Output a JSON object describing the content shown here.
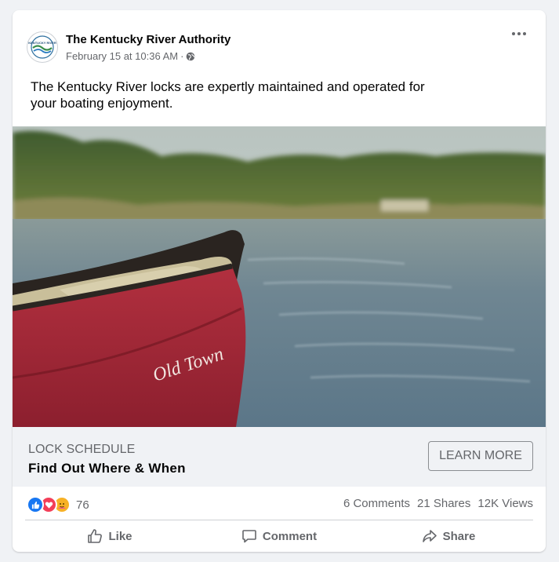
{
  "post": {
    "page_name": "The Kentucky River Authority",
    "timestamp": "February 15 at 10:36 AM",
    "separator": "·",
    "privacy_icon": "globe-icon",
    "avatar_logo_text": "KENTUCKY RIVER",
    "text": "The Kentucky River locks are expertly maintained and operated for your boating enjoyment.",
    "image_canoe_text": "Old Town"
  },
  "link_preview": {
    "caption": "LOCK SCHEDULE",
    "title": "Find Out Where & When",
    "cta_label": "LEARN MORE"
  },
  "engagement": {
    "reaction_icons": [
      "like-icon",
      "love-icon",
      "care-icon"
    ],
    "reaction_count": "76",
    "comments": "6 Comments",
    "shares": "21 Shares",
    "views": "12K Views"
  },
  "actions": {
    "like": "Like",
    "comment": "Comment",
    "share": "Share"
  },
  "colors": {
    "background": "#f0f2f5",
    "text_secondary": "#65676b",
    "like_blue": "#1877f2",
    "love_red": "#f33e58",
    "care_yellow": "#f7b125",
    "canoe_red": "#a8253a"
  }
}
